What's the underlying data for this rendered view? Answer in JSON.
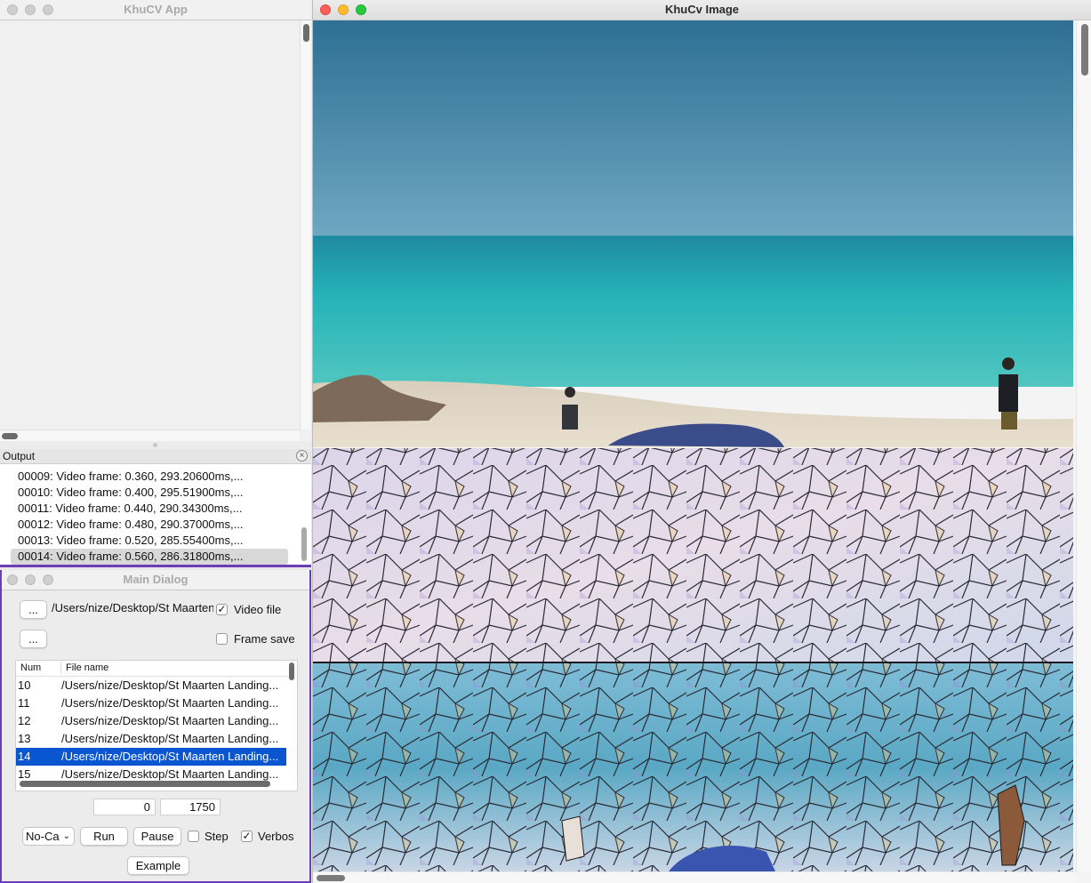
{
  "app_window": {
    "title": "KhuCV App"
  },
  "output_dock": {
    "title": "Output",
    "lines": [
      "00009: Video frame: 0.360,  293.20600ms,...",
      "00010: Video frame: 0.400,  295.51900ms,...",
      "00011: Video frame: 0.440,  290.34300ms,...",
      "00012: Video frame: 0.480,  290.37000ms,...",
      "00013: Video frame: 0.520,  285.55400ms,...",
      "00014: Video frame: 0.560,  286.31800ms,..."
    ],
    "selected_index": 5
  },
  "main_dialog": {
    "title": "Main Dialog",
    "browse_label": "...",
    "browse2_label": "...",
    "path": "/Users/nize/Desktop/St Maarten",
    "video_file_label": "Video file",
    "video_file_checked": true,
    "frame_save_label": "Frame save",
    "frame_save_checked": false,
    "table": {
      "col_num": "Num",
      "col_file": "File name",
      "rows": [
        {
          "num": "10",
          "file": "/Users/nize/Desktop/St Maarten Landing..."
        },
        {
          "num": "11",
          "file": "/Users/nize/Desktop/St Maarten Landing..."
        },
        {
          "num": "12",
          "file": "/Users/nize/Desktop/St Maarten Landing..."
        },
        {
          "num": "13",
          "file": "/Users/nize/Desktop/St Maarten Landing..."
        },
        {
          "num": "14",
          "file": "/Users/nize/Desktop/St Maarten Landing..."
        },
        {
          "num": "15",
          "file": "/Users/nize/Desktop/St Maarten Landing..."
        }
      ],
      "selected_num": "14"
    },
    "start_frame": "0",
    "end_frame": "1750",
    "camera_select": "No-Ca",
    "run_label": "Run",
    "pause_label": "Pause",
    "step_label": "Step",
    "step_checked": false,
    "verbose_label": "Verbos",
    "verbose_checked": true,
    "example_label": "Example"
  },
  "image_window": {
    "title": "KhuCv Image"
  },
  "colors": {
    "accent": "#6a3fb5",
    "selection": "#0a55d0"
  }
}
